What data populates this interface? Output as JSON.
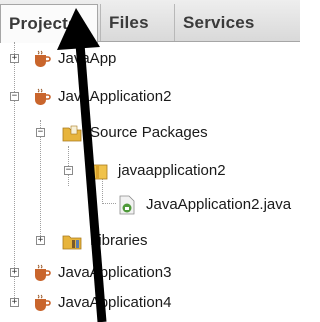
{
  "tabs": [
    {
      "label": "Projects",
      "active": true
    },
    {
      "label": "Files",
      "active": false
    },
    {
      "label": "Services",
      "active": false
    }
  ],
  "tree": [
    {
      "label": "JavaApp",
      "icon": "coffee-cup-project-icon",
      "expanded": false,
      "depth": 0
    },
    {
      "label": "JavaApplication2",
      "icon": "coffee-cup-project-icon",
      "expanded": true,
      "depth": 0
    },
    {
      "label": "Source Packages",
      "icon": "source-packages-folder-icon",
      "expanded": true,
      "depth": 1
    },
    {
      "label": "javaapplication2",
      "icon": "package-icon",
      "expanded": true,
      "depth": 2
    },
    {
      "label": "JavaApplication2.java",
      "icon": "java-file-icon",
      "depth": 3
    },
    {
      "label": "Libraries",
      "icon": "libraries-folder-icon",
      "expanded": false,
      "depth": 1
    },
    {
      "label": "JavaApplication3",
      "icon": "coffee-cup-project-icon",
      "expanded": false,
      "depth": 0
    },
    {
      "label": "JavaApplication4",
      "icon": "coffee-cup-project-icon",
      "expanded": false,
      "depth": 0
    }
  ],
  "colors": {
    "cup": "#c9652c",
    "folder": "#e7b43c",
    "package": "#f0c24a",
    "java_file_green": "#4f9a3a",
    "arrow": "#000000"
  }
}
